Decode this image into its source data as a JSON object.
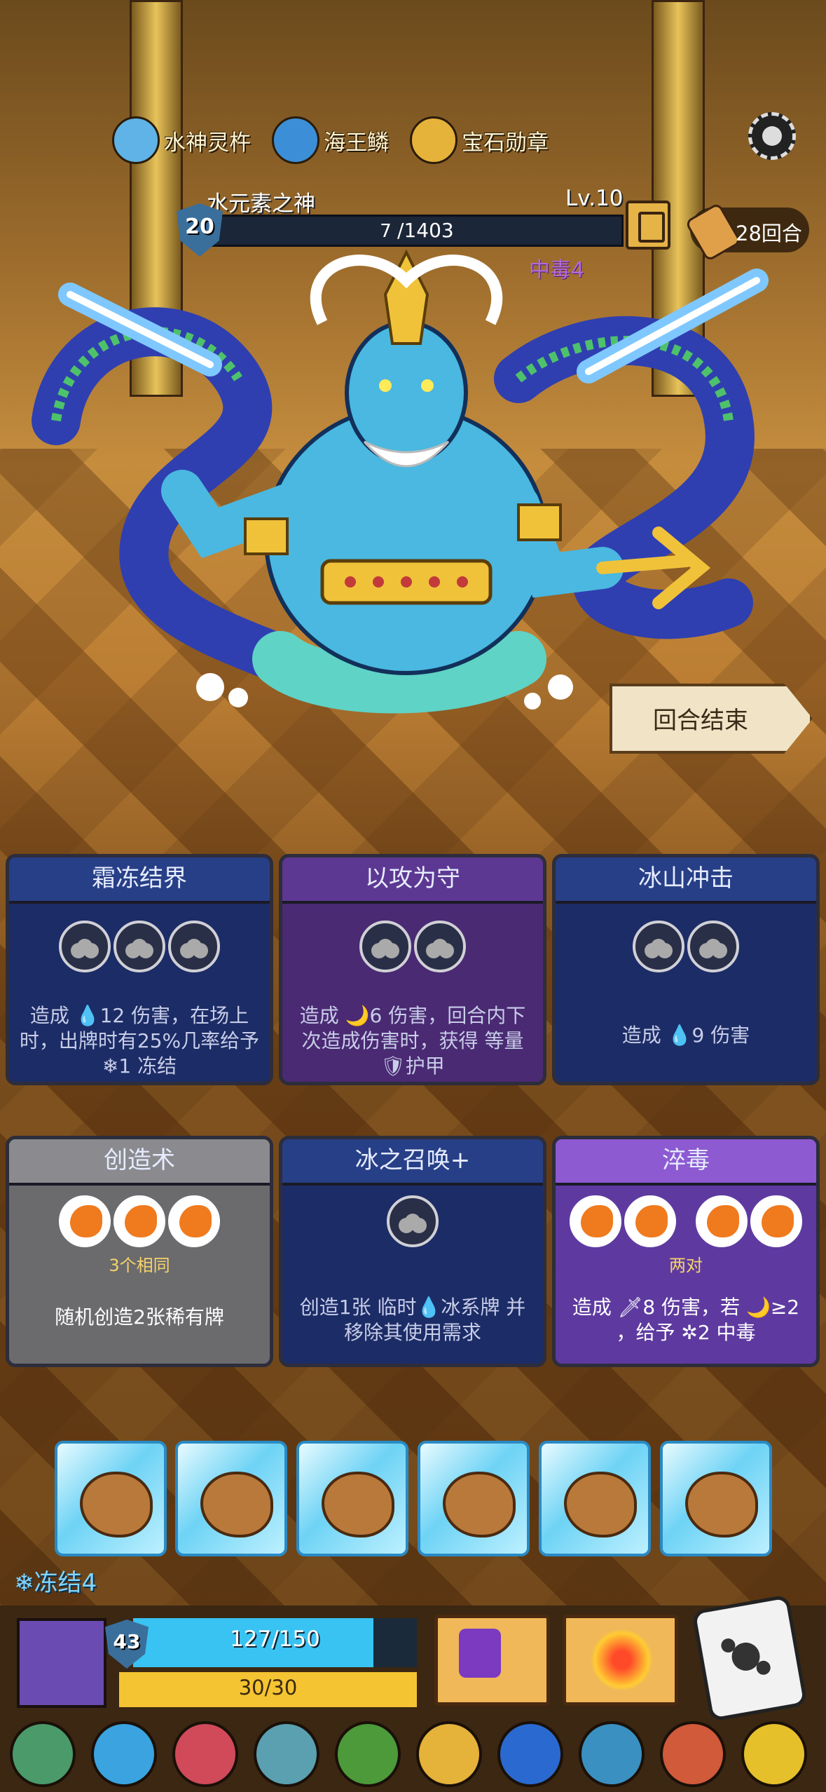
{
  "relics": [
    {
      "name": "水神灵杵",
      "icon": "trident-relic-icon",
      "color": "#5fb3e6"
    },
    {
      "name": "海王鳞",
      "icon": "scale-relic-icon",
      "color": "#3c8fd6"
    },
    {
      "name": "宝石勋章",
      "icon": "gem-medal-relic-icon",
      "color": "#e5b23a"
    }
  ],
  "boss": {
    "name": "水元素之神",
    "level": "Lv.10",
    "shield": "20",
    "hp_current": "7",
    "hp_max": "/1403",
    "hp_fraction": 0.005,
    "status_poison": "中毒4"
  },
  "round": "28回合",
  "end_turn_label": "回合结束",
  "cards": [
    {
      "title": "霜冻结界",
      "desc": "造成 💧12 伤害，在场上时，出牌时有25%几率给予 ❄1 冻结",
      "dice": 3
    },
    {
      "title": "以攻为守",
      "desc": "造成 🌙6 伤害，回合内下次造成伤害时，获得 等量🛡护甲",
      "dice": 2
    },
    {
      "title": "冰山冲击",
      "desc": "造成 💧9 伤害",
      "dice": 2
    },
    {
      "title": "创造术",
      "sub": "3个相同",
      "desc": "随机创造2张稀有牌",
      "dice": 3
    },
    {
      "title": "冰之召唤+",
      "desc": "创造1张 临时💧冰系牌 并移除其使用需求",
      "dice": 1
    },
    {
      "title": "淬毒",
      "sub": "两对",
      "desc": "造成 🗡8 伤害，若 🌙≥2 ，给予 ✲2 中毒",
      "dice": 4
    }
  ],
  "frozen_dice_count": 6,
  "freeze_status": "冻结4",
  "player": {
    "level": "43",
    "hp_text": "127/150",
    "hp_fraction": 0.847,
    "energy_text": "30/30",
    "energy_fraction": 1.0
  },
  "bottom_relics": [
    {
      "icon": "leaf-relic-icon",
      "color": "#4a9a6a"
    },
    {
      "icon": "water-drop-relic-icon",
      "color": "#3aa3e0"
    },
    {
      "icon": "ring-relic-icon",
      "color": "#d04a5a"
    },
    {
      "icon": "vase-relic-icon",
      "color": "#5aa0b0"
    },
    {
      "icon": "cactus-relic-icon",
      "color": "#4c9a3a"
    },
    {
      "icon": "gem-medal-relic-icon",
      "color": "#e5b23a"
    },
    {
      "icon": "crown-relic-icon",
      "color": "#2a6ad0"
    },
    {
      "icon": "shield-relic-icon",
      "color": "#3a90c0"
    },
    {
      "icon": "meat-relic-icon",
      "color": "#d05a3a"
    },
    {
      "icon": "gold-box-relic-icon",
      "color": "#e6c02a"
    }
  ]
}
